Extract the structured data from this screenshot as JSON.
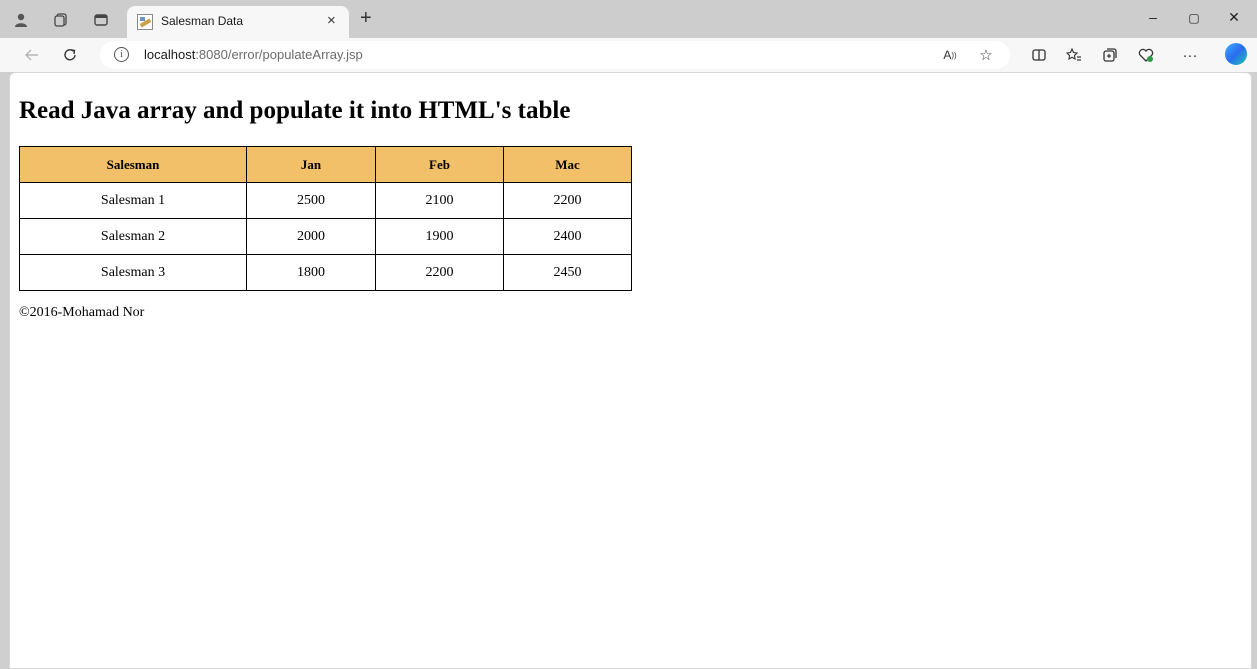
{
  "browser": {
    "tab_title": "Salesman Data",
    "tab_close": "×",
    "new_tab": "+",
    "url_host": "localhost",
    "url_path": ":8080/error/populateArray.jsp",
    "controls": {
      "minimize": "–",
      "restore": "▢",
      "close": "✕"
    }
  },
  "page": {
    "heading": "Read Java array and populate it into HTML's table",
    "table": {
      "headers": [
        "Salesman",
        "Jan",
        "Feb",
        "Mac"
      ],
      "rows": [
        [
          "Salesman 1",
          "2500",
          "2100",
          "2200"
        ],
        [
          "Salesman 2",
          "2000",
          "1900",
          "2400"
        ],
        [
          "Salesman 3",
          "1800",
          "2200",
          "2450"
        ]
      ]
    },
    "footer": "©2016-Mohamad Nor"
  },
  "colors": {
    "header_bg": "#f2c069",
    "tabstrip_bg": "#cdcdcd",
    "toolbar_bg": "#f7f7f7"
  }
}
